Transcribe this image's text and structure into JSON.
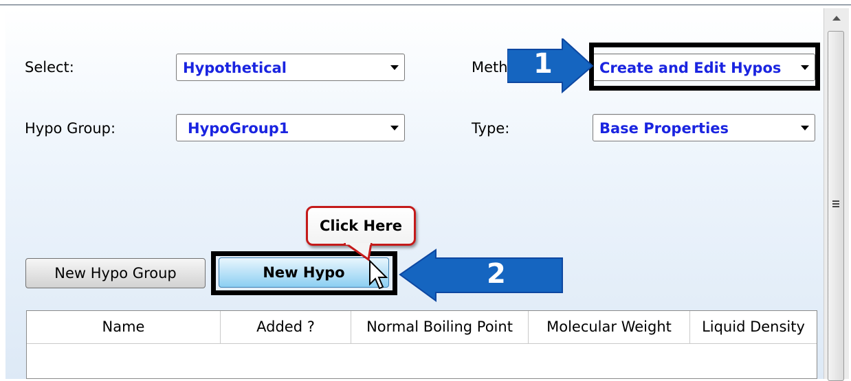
{
  "form": {
    "select_label": "Select:",
    "select_value": "Hypothetical",
    "method_label": "Meth",
    "method_value": "Create and Edit Hypos",
    "hypo_group_label": "Hypo Group:",
    "hypo_group_value": "HypoGroup1",
    "type_label": "Type:",
    "type_value": "Base Properties"
  },
  "buttons": {
    "new_hypo_group": "New Hypo Group",
    "new_hypo": "New Hypo"
  },
  "table": {
    "columns": [
      "Name",
      "Added ?",
      "Normal Boiling Point",
      "Molecular Weight",
      "Liquid Density"
    ]
  },
  "annotations": {
    "callout": "Click Here",
    "step1": "1",
    "step2": "2"
  },
  "colors": {
    "value_text": "#1a24e0",
    "arrow_blue": "#1565c0",
    "callout_border": "#c41a1a"
  }
}
